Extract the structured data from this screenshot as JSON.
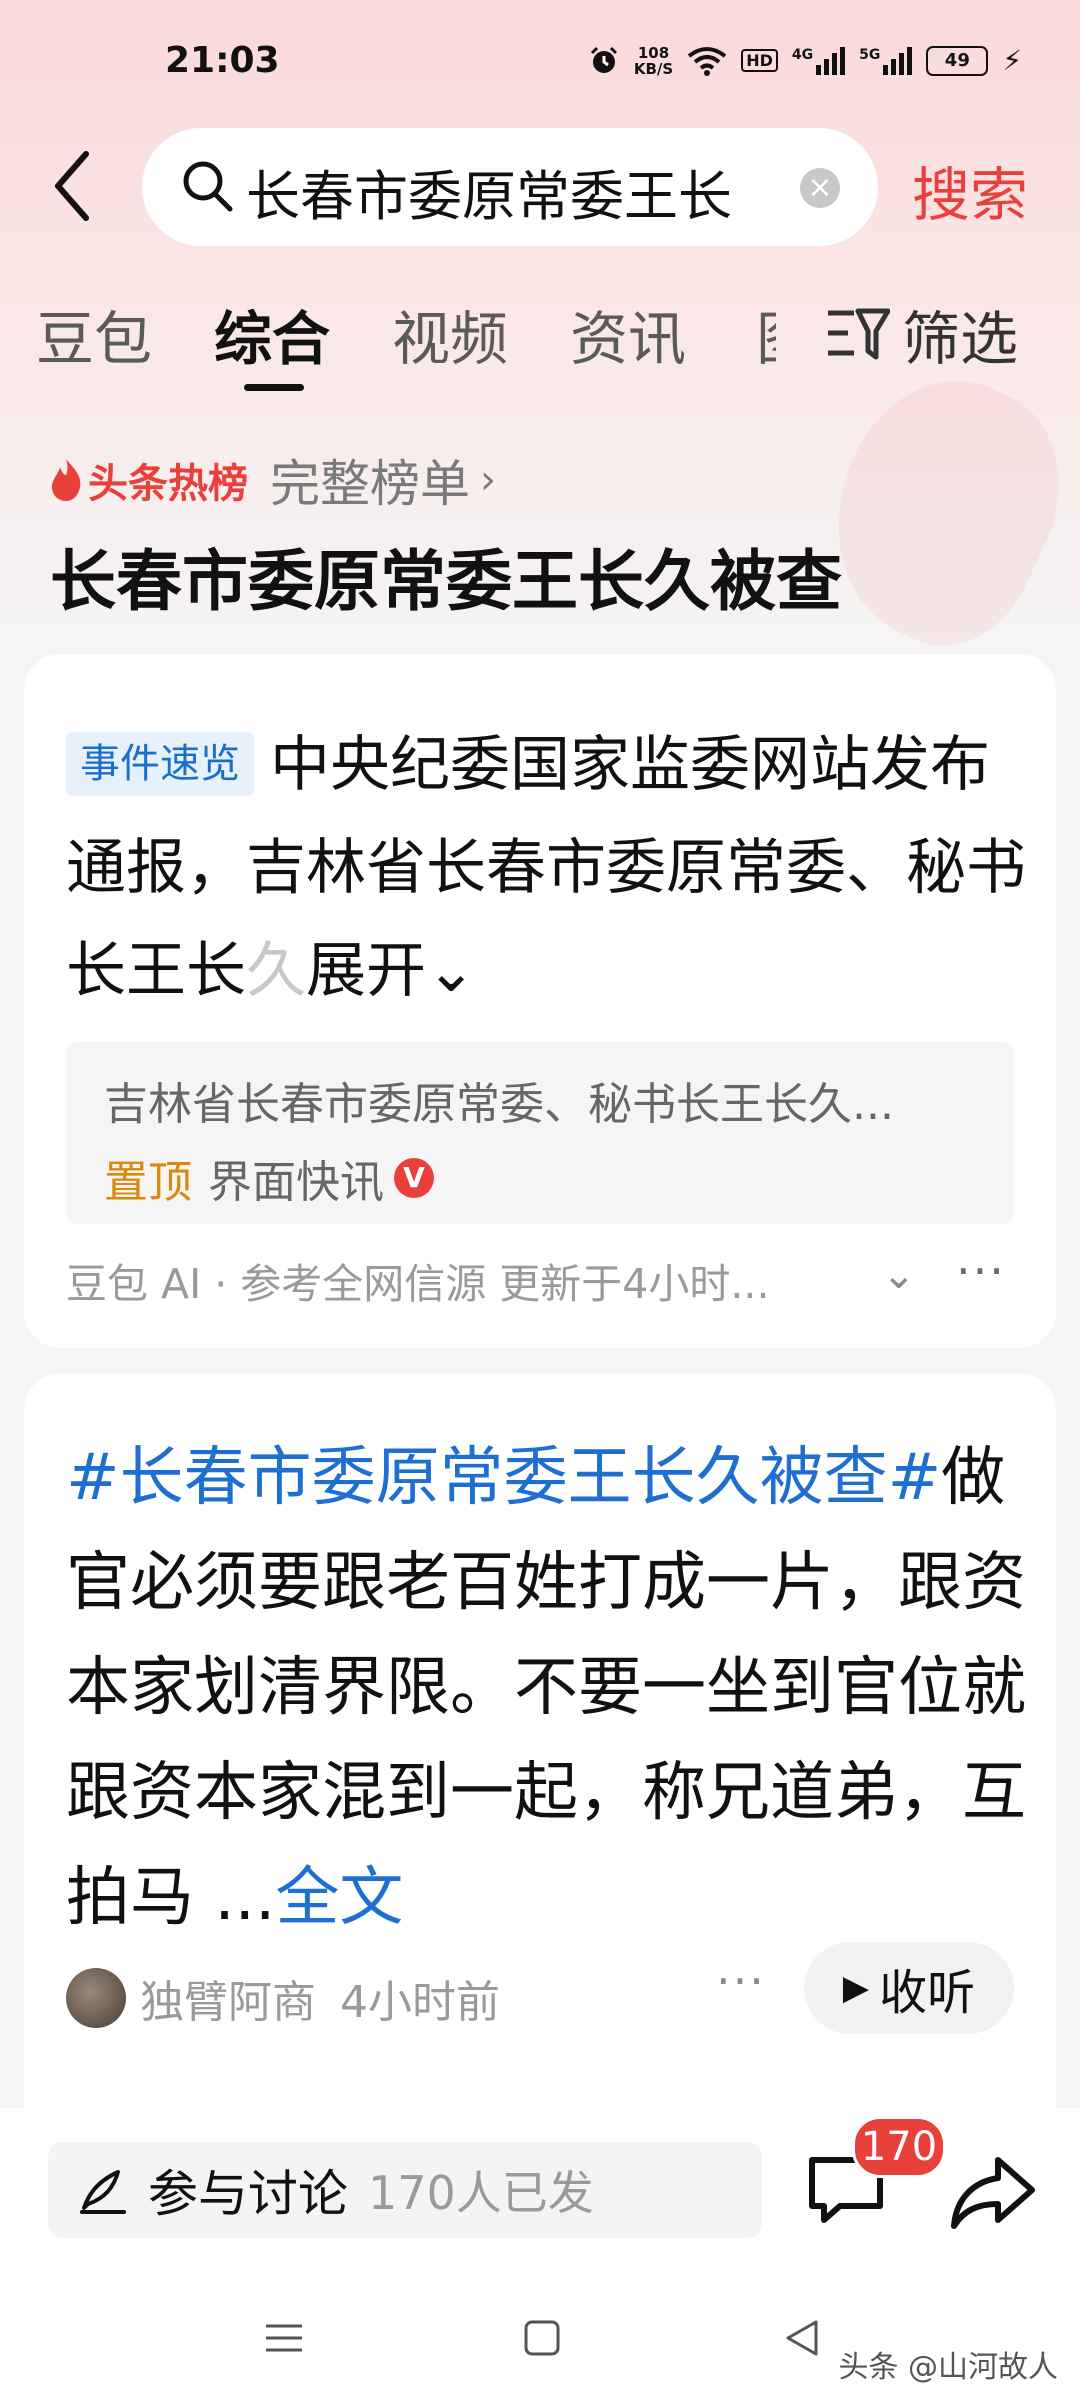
{
  "status_bar": {
    "time": "21:03",
    "net_speed_value": "108",
    "net_speed_unit": "KB/S",
    "hd_label": "HD",
    "signal1_label": "4G",
    "signal2_label": "5G",
    "battery": "49",
    "icons": [
      "alarm-icon",
      "wifi-icon",
      "signal-icon",
      "battery-icon",
      "charging-icon"
    ]
  },
  "search": {
    "query": "长春市委原常委王长",
    "clear_symbol": "×",
    "button_label": "搜索"
  },
  "tabs": [
    {
      "label": "豆包"
    },
    {
      "label": "综合"
    },
    {
      "label": "视频"
    },
    {
      "label": "资讯"
    }
  ],
  "tab_cut_label": "图",
  "filter_label": "筛选",
  "hot_list": {
    "label": "头条热榜",
    "full_list_label": "完整榜单",
    "chevron": "›",
    "topic_title": "长春市委原常委王长久被查"
  },
  "event_card": {
    "badge": "事件速览",
    "text": "中央纪委国家监委网站发布通报，吉林省长春市委原常委、秘书长王长",
    "faded_char": "久",
    "expand_label": "展开",
    "expand_chevron": "⌄",
    "source_title": "吉林省长春市委原常委、秘书长王长久...",
    "pin_label": "置顶",
    "source_name": "界面快讯",
    "verified_mark": "V",
    "ai_footer": "豆包 AI · 参考全网信源 更新于4小时...",
    "footer_chevron": "⌄",
    "more_symbol": "···"
  },
  "post_card": {
    "hashtag": "#长春市委原常委王长久被查#",
    "text": "做官必须要跟老百姓打成一片，跟资本家划清界限。不要一坐到官位就跟资本家混到一起，称兄道弟，互拍马 ...",
    "full_text_label": "全文",
    "author": "独臂阿商",
    "time_ago": "4小时前",
    "more_symbol": "···",
    "listen_label": "收听",
    "play_symbol": "▶"
  },
  "bottom_bar": {
    "discuss_label": "参与讨论",
    "discuss_count": "170人已发",
    "comment_count": "170"
  },
  "nav_bar": {
    "icons": [
      "menu-icon",
      "home-icon",
      "back-icon"
    ]
  },
  "watermark": "头条 @山河故人"
}
